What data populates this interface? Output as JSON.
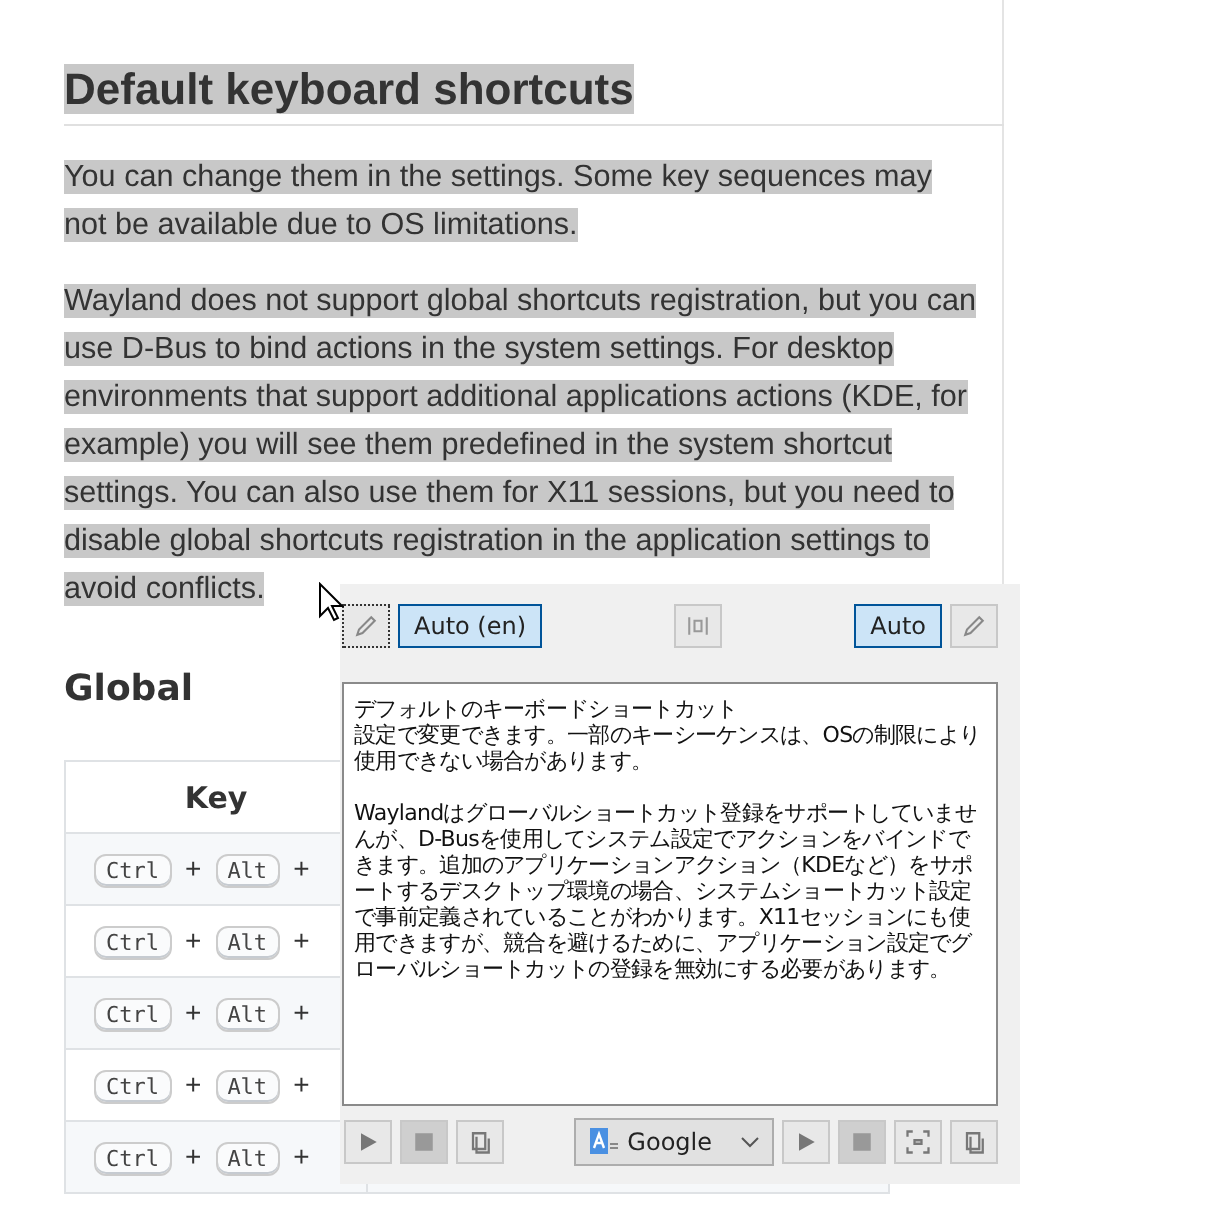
{
  "heading": {
    "text": "Default keyboard shortcuts",
    "selected": true
  },
  "paragraphs": [
    {
      "text": "You can change them in the settings. Some key sequences may not be available due to OS limitations.",
      "selected": true
    },
    {
      "text": "Wayland does not support global shortcuts registration, but you can use D-Bus to bind actions in the system settings. For desktop environments that support additional applications actions (KDE, for example) you will see them predefined in the system shortcut settings. You can also use them for X11 sessions, but you need to disable global shortcuts registration in the application settings to avoid conflicts.",
      "selected": true
    }
  ],
  "section_title": "Global",
  "table": {
    "columns": [
      "Key"
    ],
    "rows": [
      {
        "keys": [
          "Ctrl",
          "+",
          "Alt",
          "+"
        ]
      },
      {
        "keys": [
          "Ctrl",
          "+",
          "Alt",
          "+"
        ]
      },
      {
        "keys": [
          "Ctrl",
          "+",
          "Alt",
          "+"
        ]
      },
      {
        "keys": [
          "Ctrl",
          "+",
          "Alt",
          "+"
        ]
      },
      {
        "keys": [
          "Ctrl",
          "+",
          "Alt",
          "+"
        ]
      }
    ]
  },
  "popup": {
    "source_language": {
      "label": "Auto (en)",
      "selected": true
    },
    "target_language": {
      "label": "Auto",
      "selected": true
    },
    "translation": [
      {
        "lines": [
          "デフォルトのキーボードショートカット",
          "設定で変更できます。一部のキーシーケンスは、OSの制限により使用できない場合があります。"
        ]
      },
      {
        "lines": [
          "Waylandはグローバルショートカット登録をサポートしていませんが、D-Busを使用してシステム設定でアクションをバインドできます。追加のアプリケーションアクション（KDEなど）をサポートするデスクトップ環境の場合、システムショートカット設定で事前定義されていることがわかります。X11セッションにも使用できますが、競合を避けるために、アプリケーション設定でグローバルショートカットの登録を無効にする必要があります。"
        ]
      }
    ],
    "engine": "Google"
  }
}
